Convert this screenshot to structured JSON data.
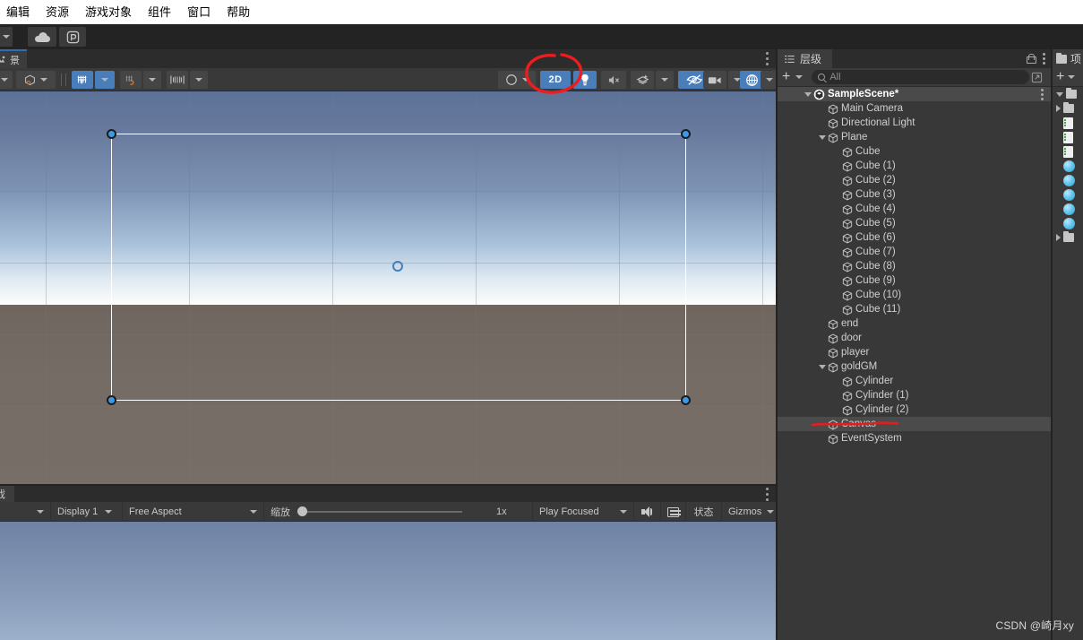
{
  "menubar": {
    "items": [
      {
        "label": "编辑",
        "name": "menu-edit"
      },
      {
        "label": "资源",
        "name": "menu-assets"
      },
      {
        "label": "游戏对象",
        "name": "menu-gameobject"
      },
      {
        "label": "组件",
        "name": "menu-component"
      },
      {
        "label": "窗口",
        "name": "menu-window"
      },
      {
        "label": "帮助",
        "name": "menu-help"
      }
    ]
  },
  "toptoolbar": {
    "cloud_icon": "cloud-icon",
    "collab_icon": "unity-services-icon",
    "play_icon": "play-icon",
    "pause_icon": "pause-icon",
    "step_icon": "step-icon"
  },
  "scene_panel": {
    "tab_label": "景",
    "toolbar": {
      "tool_dropdown_caret": "chevron-down-icon",
      "pivot_icon": "pivot-center-icon",
      "grid_snap_icon": "grid-snap-icon",
      "snap_increment_icon": "snap-increment-icon",
      "ruler_icon": "ruler-icon",
      "shading_icon": "shading-mode-icon",
      "button_2d_label": "2D",
      "light_icon": "lighting-icon",
      "audio_icon": "audio-mute-icon",
      "fx_icon": "effects-icon",
      "visibility_icon": "scene-visibility-icon",
      "camera_icon": "scene-camera-icon",
      "gizmos_icon": "gizmos-icon"
    },
    "selection": {
      "handle_icon": "rect-handle",
      "pivot_icon": "pivot-circle"
    }
  },
  "annotation": {
    "circle_color": "#ee1c1c",
    "underline_color": "#e02020",
    "circle_target": "2D button",
    "underline_target": "Canvas hierarchy item"
  },
  "game_panel": {
    "tab_label": "戏",
    "toolbar": {
      "left_caret": "chevron-down-icon",
      "display_label": "Display 1",
      "aspect_label": "Free Aspect",
      "scale_label": "缩放",
      "scale_value": "1x",
      "play_mode_label": "Play Focused",
      "mute_icon": "speaker-icon",
      "keyboard_icon": "keyboard-icon",
      "stats_label": "状态",
      "gizmos_label": "Gizmos"
    }
  },
  "hierarchy": {
    "tab_label": "层级",
    "tab_icon": "hierarchy-icon",
    "lock_icon": "lock-icon",
    "menu_icon": "kebab-menu-icon",
    "add_label": "+",
    "search_placeholder": "All",
    "search_icon": "search-icon",
    "search_save_icon": "save-search-icon",
    "items": [
      {
        "label": "SampleScene*",
        "depth": 0,
        "icon": "unity-scene-icon",
        "expanded": true,
        "scene": true
      },
      {
        "label": "Main Camera",
        "depth": 1,
        "icon": "gameobject-cube-icon",
        "expanded": null
      },
      {
        "label": "Directional Light",
        "depth": 1,
        "icon": "gameobject-cube-icon",
        "expanded": null
      },
      {
        "label": "Plane",
        "depth": 1,
        "icon": "gameobject-cube-icon",
        "expanded": true
      },
      {
        "label": "Cube",
        "depth": 2,
        "icon": "gameobject-cube-icon",
        "expanded": null
      },
      {
        "label": "Cube (1)",
        "depth": 2,
        "icon": "gameobject-cube-icon",
        "expanded": null
      },
      {
        "label": "Cube (2)",
        "depth": 2,
        "icon": "gameobject-cube-icon",
        "expanded": null
      },
      {
        "label": "Cube (3)",
        "depth": 2,
        "icon": "gameobject-cube-icon",
        "expanded": null
      },
      {
        "label": "Cube (4)",
        "depth": 2,
        "icon": "gameobject-cube-icon",
        "expanded": null
      },
      {
        "label": "Cube (5)",
        "depth": 2,
        "icon": "gameobject-cube-icon",
        "expanded": null
      },
      {
        "label": "Cube (6)",
        "depth": 2,
        "icon": "gameobject-cube-icon",
        "expanded": null
      },
      {
        "label": "Cube (7)",
        "depth": 2,
        "icon": "gameobject-cube-icon",
        "expanded": null
      },
      {
        "label": "Cube (8)",
        "depth": 2,
        "icon": "gameobject-cube-icon",
        "expanded": null
      },
      {
        "label": "Cube (9)",
        "depth": 2,
        "icon": "gameobject-cube-icon",
        "expanded": null
      },
      {
        "label": "Cube (10)",
        "depth": 2,
        "icon": "gameobject-cube-icon",
        "expanded": null
      },
      {
        "label": "Cube (11)",
        "depth": 2,
        "icon": "gameobject-cube-icon",
        "expanded": null
      },
      {
        "label": "end",
        "depth": 1,
        "icon": "gameobject-cube-icon",
        "expanded": null
      },
      {
        "label": "door",
        "depth": 1,
        "icon": "gameobject-cube-icon",
        "expanded": null
      },
      {
        "label": "player",
        "depth": 1,
        "icon": "gameobject-cube-icon",
        "expanded": null
      },
      {
        "label": "goldGM",
        "depth": 1,
        "icon": "gameobject-cube-icon",
        "expanded": true
      },
      {
        "label": "Cylinder",
        "depth": 2,
        "icon": "gameobject-cube-icon",
        "expanded": null
      },
      {
        "label": "Cylinder (1)",
        "depth": 2,
        "icon": "gameobject-cube-icon",
        "expanded": null
      },
      {
        "label": "Cylinder (2)",
        "depth": 2,
        "icon": "gameobject-cube-icon",
        "expanded": null
      },
      {
        "label": "Canvas",
        "depth": 1,
        "icon": "gameobject-cube-icon",
        "expanded": null,
        "selected": true
      },
      {
        "label": "EventSystem",
        "depth": 1,
        "icon": "gameobject-cube-icon",
        "expanded": null
      }
    ]
  },
  "project": {
    "tab_label": "项",
    "tab_icon": "project-folder-icon",
    "add_label": "+",
    "rows": [
      {
        "icon": "folder-open-icon",
        "expanded": true
      },
      {
        "icon": "folder-closed-icon",
        "expanded": false
      },
      {
        "icon": "script-file-icon"
      },
      {
        "icon": "script-file-icon"
      },
      {
        "icon": "script-file-icon"
      },
      {
        "icon": "material-ball-icon"
      },
      {
        "icon": "material-ball-icon"
      },
      {
        "icon": "material-ball-icon"
      },
      {
        "icon": "material-ball-icon"
      },
      {
        "icon": "material-ball-icon"
      },
      {
        "icon": "folder-closed-icon",
        "expanded": false
      }
    ]
  },
  "watermark": {
    "text": "CSDN @崎月xy"
  }
}
